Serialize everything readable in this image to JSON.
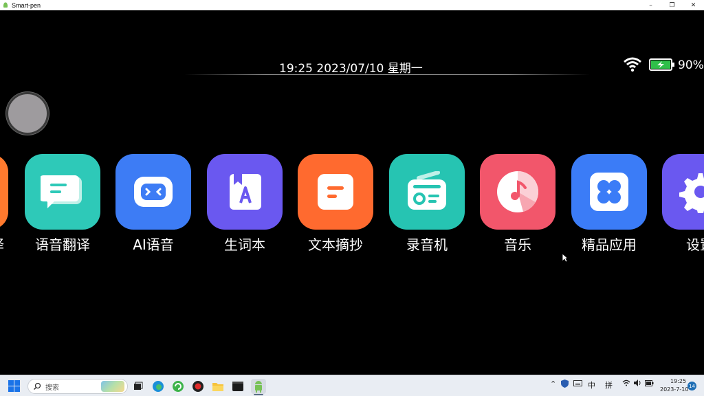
{
  "window": {
    "title": "Smart-pen",
    "controls": {
      "minimize": "–",
      "restore": "❐",
      "close": "✕"
    }
  },
  "status_bar": {
    "datetime": "19:25 2023/07/10 星期一",
    "battery_percent": "90%",
    "battery_level": 0.9,
    "wifi_icon": "wifi-icon",
    "battery_icon": "battery-charging-icon"
  },
  "apps": [
    {
      "label": "语音翻译",
      "icon": "chat-translate-icon",
      "color": "#2ec9b8"
    },
    {
      "label": "AI语音",
      "icon": "robot-face-icon",
      "color": "#3d7cf5"
    },
    {
      "label": "生词本",
      "icon": "vocab-book-icon",
      "color": "#6a58f0"
    },
    {
      "label": "文本摘抄",
      "icon": "text-excerpt-icon",
      "color": "#ff6a2f"
    },
    {
      "label": "录音机",
      "icon": "radio-recorder-icon",
      "color": "#26c4b2"
    },
    {
      "label": "音乐",
      "icon": "music-disc-icon",
      "color": "#f2566b"
    },
    {
      "label": "精品应用",
      "icon": "app-grid-icon",
      "color": "#3b7cf7"
    },
    {
      "label": "设置",
      "icon": "gear-icon",
      "color": "#6a58f0"
    }
  ],
  "partial_left_label": "译",
  "taskbar": {
    "search_placeholder": "搜索",
    "ime_mode": "中",
    "ime_pinyin": "拼",
    "clock_time": "19:25",
    "clock_date": "2023-7-10",
    "notification_count": "14"
  }
}
